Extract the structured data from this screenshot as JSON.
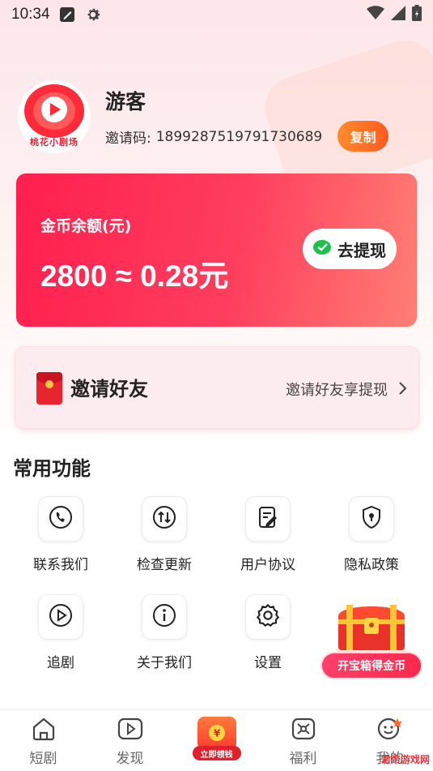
{
  "status_bar": {
    "time": "10:34"
  },
  "profile": {
    "name": "游客",
    "invite_label": "邀请码:",
    "invite_code": "1899287519791730689",
    "copy_label": "复制",
    "avatar_caption": "桃花小剧场"
  },
  "coin_card": {
    "label": "金币余额(元)",
    "value": "2800 ≈ 0.28元",
    "withdraw_label": "去提现"
  },
  "invite_card": {
    "title": "邀请好友",
    "hint": "邀请好友享提现"
  },
  "functions": {
    "title": "常用功能",
    "items": [
      {
        "label": "联系我们",
        "icon": "phone-icon"
      },
      {
        "label": "检查更新",
        "icon": "update-arrows-icon"
      },
      {
        "label": "用户协议",
        "icon": "document-edit-icon"
      },
      {
        "label": "隐私政策",
        "icon": "shield-lock-icon"
      },
      {
        "label": "追剧",
        "icon": "play-circle-icon"
      },
      {
        "label": "关于我们",
        "icon": "info-icon"
      },
      {
        "label": "设置",
        "icon": "gear-icon"
      }
    ]
  },
  "treasure": {
    "label": "开宝箱得金币"
  },
  "bottom_nav": {
    "items": [
      {
        "label": "短剧",
        "icon": "home-icon"
      },
      {
        "label": "发现",
        "icon": "play-square-icon"
      },
      {
        "label": "立即领钱",
        "icon": "red-packet-icon"
      },
      {
        "label": "福利",
        "icon": "gift-grid-icon"
      },
      {
        "label": "我的",
        "icon": "smiley-icon"
      }
    ]
  },
  "watermark": "君帝游戏网",
  "colors": {
    "accent": "#ff2a55",
    "copy_button": "#ff6a24",
    "wechat_green": "#1fbf4e"
  }
}
